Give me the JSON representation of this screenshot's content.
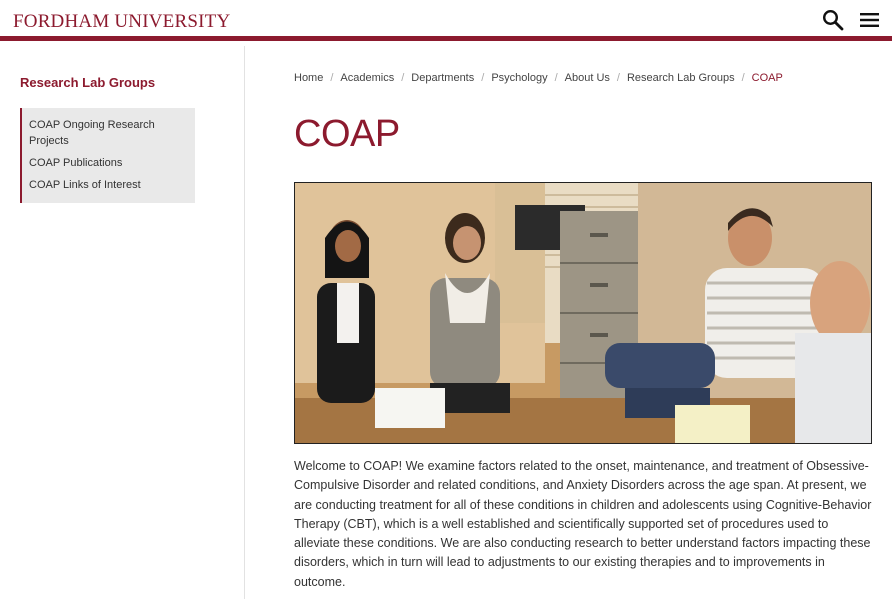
{
  "header": {
    "logo_text": "FORDHAM UNIVERSITY",
    "icons": [
      "search-icon",
      "menu-icon"
    ],
    "accent_color": "#8c1a2e"
  },
  "sidebar": {
    "title": "Research Lab Groups",
    "items": [
      {
        "label": "COAP Ongoing Research Projects"
      },
      {
        "label": "COAP Publications"
      },
      {
        "label": "COAP Links of Interest"
      }
    ]
  },
  "breadcrumb": {
    "items": [
      "Home",
      "Academics",
      "Departments",
      "Psychology",
      "About Us",
      "Research Lab Groups"
    ],
    "current": "COAP"
  },
  "main": {
    "title": "COAP",
    "intro": "Welcome to COAP! We examine factors related to the onset, maintenance, and treatment of Obsessive-Compulsive Disorder and related conditions, and Anxiety Disorders across the age span. At present, we are conducting treatment for all of these conditions in children and adolescents using Cognitive-Behavior Therapy (CBT), which is a well established and scientifically supported set of procedures used to alleviate these conditions. We are also conducting research to better understand factors impacting these disorders, which in turn will lead to adjustments to our existing therapies and to improvements in outcome."
  }
}
